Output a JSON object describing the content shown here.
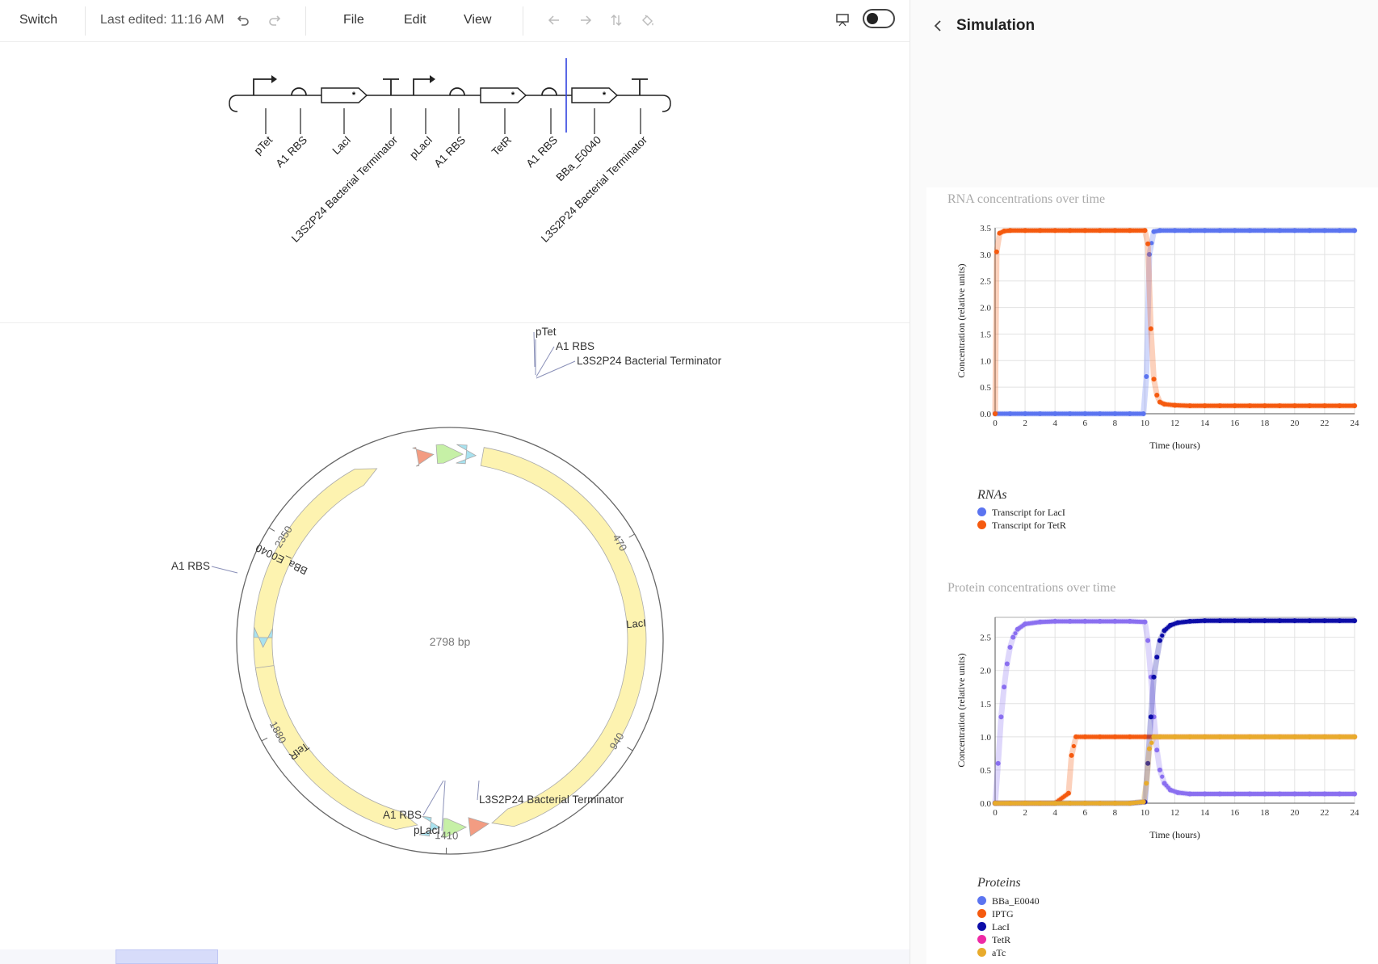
{
  "toolbar": {
    "switch_label": "Switch",
    "last_edited": "Last edited: 11:16 AM",
    "menu": [
      "File",
      "Edit",
      "View"
    ]
  },
  "linear_design": {
    "parts": [
      {
        "name": "pTet",
        "glyph": "promoter"
      },
      {
        "name": "A1 RBS",
        "glyph": "rbs"
      },
      {
        "name": "LacI",
        "glyph": "cds"
      },
      {
        "name": "L3S2P24 Bacterial Terminator",
        "glyph": "terminator"
      },
      {
        "name": "pLacI",
        "glyph": "promoter"
      },
      {
        "name": "A1 RBS",
        "glyph": "rbs"
      },
      {
        "name": "TetR",
        "glyph": "cds"
      },
      {
        "name": "A1 RBS",
        "glyph": "rbs"
      },
      {
        "name": "BBa_E0040",
        "glyph": "cds"
      },
      {
        "name": "L3S2P24 Bacterial Terminator",
        "glyph": "terminator"
      }
    ]
  },
  "plasmid": {
    "length_label": "2798 bp",
    "ticks": [
      "470",
      "940",
      "1410",
      "1880",
      "2350"
    ],
    "feature_labels": [
      "BBa_E0040",
      "LacI",
      "TetR"
    ],
    "callouts": [
      "pTet",
      "A1 RBS",
      "L3S2P24 Bacterial Terminator",
      "A1 RBS",
      "A1 RBS",
      "pLacI",
      "L3S2P24 Bacterial Terminator"
    ],
    "colors": {
      "cds": "#fdf3b0",
      "promoter": "#c6f0a6",
      "rbs": "#a8e2ef",
      "terminator": "#f39c82"
    }
  },
  "simulation": {
    "title": "Simulation",
    "rna_chart": {
      "title": "RNA concentrations over time",
      "xlabel": "Time (hours)",
      "ylabel": "Concentration (relative units)",
      "legend_title": "RNAs",
      "legend": [
        {
          "label": "Transcript for LacI",
          "color": "#5b74f0"
        },
        {
          "label": "Transcript for TetR",
          "color": "#f55a0f"
        }
      ]
    },
    "protein_chart": {
      "title": "Protein concentrations over time",
      "xlabel": "Time (hours)",
      "ylabel": "Concentration (relative units)",
      "legend_title": "Proteins",
      "legend": [
        {
          "label": "BBa_E0040",
          "color": "#5b74f0"
        },
        {
          "label": "IPTG",
          "color": "#f55a0f"
        },
        {
          "label": "LacI",
          "color": "#0d0da8"
        },
        {
          "label": "TetR",
          "color": "#ee2aa5"
        },
        {
          "label": "aTc",
          "color": "#e8ab2c"
        }
      ]
    }
  },
  "chart_data": [
    {
      "type": "scatter",
      "title": "RNA concentrations over time",
      "xlabel": "Time (hours)",
      "ylabel": "Concentration (relative units)",
      "xlim": [
        0,
        24
      ],
      "ylim": [
        0,
        3.5
      ],
      "xticks": [
        0,
        2,
        4,
        6,
        8,
        10,
        12,
        14,
        16,
        18,
        20,
        22,
        24
      ],
      "yticks": [
        0,
        0.5,
        1.0,
        1.5,
        2.0,
        2.5,
        3.0,
        3.5
      ],
      "grid": true,
      "legend_position": "bottom-left",
      "series": [
        {
          "name": "Transcript for LacI",
          "color": "#5b74f0",
          "x": [
            0,
            1,
            2,
            3,
            4,
            5,
            6,
            7,
            8,
            9,
            9.9,
            10.1,
            10.3,
            10.6,
            11,
            12,
            13,
            14,
            15,
            16,
            17,
            18,
            19,
            20,
            21,
            22,
            23,
            24
          ],
          "y": [
            0,
            0,
            0,
            0,
            0,
            0,
            0,
            0,
            0,
            0,
            0,
            0.7,
            3.0,
            3.43,
            3.45,
            3.45,
            3.45,
            3.45,
            3.45,
            3.45,
            3.45,
            3.45,
            3.45,
            3.45,
            3.45,
            3.45,
            3.45,
            3.45
          ]
        },
        {
          "name": "Transcript for TetR",
          "color": "#f55a0f",
          "x": [
            0,
            0.1,
            0.3,
            0.6,
            1,
            2,
            3,
            4,
            5,
            6,
            7,
            8,
            9,
            10,
            10.2,
            10.4,
            10.6,
            10.8,
            11,
            11.3,
            12,
            13,
            14,
            15,
            16,
            17,
            18,
            19,
            20,
            21,
            22,
            23,
            24
          ],
          "y": [
            0,
            3.05,
            3.4,
            3.44,
            3.45,
            3.45,
            3.45,
            3.45,
            3.45,
            3.45,
            3.45,
            3.45,
            3.45,
            3.45,
            3.2,
            1.6,
            0.65,
            0.35,
            0.22,
            0.18,
            0.16,
            0.15,
            0.15,
            0.15,
            0.15,
            0.15,
            0.15,
            0.15,
            0.15,
            0.15,
            0.15,
            0.15,
            0.15
          ]
        }
      ]
    },
    {
      "type": "scatter",
      "title": "Protein concentrations over time",
      "xlabel": "Time (hours)",
      "ylabel": "Concentration (relative units)",
      "xlim": [
        0,
        24
      ],
      "ylim": [
        0,
        2.8
      ],
      "xticks": [
        0,
        2,
        4,
        6,
        8,
        10,
        12,
        14,
        16,
        18,
        20,
        22,
        24
      ],
      "yticks": [
        0,
        0.5,
        1.0,
        1.5,
        2.0,
        2.5
      ],
      "grid": true,
      "legend_position": "bottom-left",
      "series": [
        {
          "name": "BBa_E0040",
          "color": "#8a6ff0",
          "x": [
            0,
            0.2,
            0.4,
            0.6,
            0.8,
            1.0,
            1.2,
            1.5,
            2,
            3,
            4,
            5,
            6,
            7,
            8,
            9,
            10,
            10.2,
            10.4,
            10.6,
            10.8,
            11,
            11.3,
            11.7,
            12.2,
            13,
            14,
            15,
            16,
            17,
            18,
            19,
            20,
            21,
            22,
            23,
            24
          ],
          "y": [
            0,
            0.6,
            1.3,
            1.75,
            2.1,
            2.35,
            2.5,
            2.62,
            2.7,
            2.73,
            2.74,
            2.74,
            2.74,
            2.74,
            2.74,
            2.74,
            2.73,
            2.45,
            1.9,
            1.3,
            0.8,
            0.5,
            0.3,
            0.2,
            0.16,
            0.14,
            0.14,
            0.14,
            0.14,
            0.14,
            0.14,
            0.14,
            0.14,
            0.14,
            0.14,
            0.14,
            0.14
          ]
        },
        {
          "name": "IPTG",
          "color": "#f55a0f",
          "x": [
            0,
            1,
            2,
            3,
            4,
            4.9,
            5.1,
            5.4,
            6,
            7,
            8,
            9,
            10,
            11,
            12,
            13,
            14,
            15,
            16,
            17,
            18,
            19,
            20,
            21,
            22,
            23,
            24
          ],
          "y": [
            0,
            0,
            0,
            0,
            0,
            0.15,
            0.72,
            1.0,
            1.0,
            1.0,
            1.0,
            1.0,
            1.0,
            1.0,
            1.0,
            1.0,
            1.0,
            1.0,
            1.0,
            1.0,
            1.0,
            1.0,
            1.0,
            1.0,
            1.0,
            1.0,
            1.0
          ]
        },
        {
          "name": "LacI",
          "color": "#0d0da8",
          "x": [
            0,
            1,
            2,
            3,
            4,
            5,
            6,
            7,
            8,
            9,
            10,
            10.2,
            10.4,
            10.6,
            10.8,
            11,
            11.3,
            11.7,
            12.2,
            13,
            14,
            15,
            16,
            17,
            18,
            19,
            20,
            21,
            22,
            23,
            24
          ],
          "y": [
            0,
            0,
            0,
            0,
            0,
            0,
            0,
            0,
            0,
            0,
            0.02,
            0.6,
            1.3,
            1.9,
            2.2,
            2.45,
            2.6,
            2.68,
            2.72,
            2.74,
            2.75,
            2.75,
            2.75,
            2.75,
            2.75,
            2.75,
            2.75,
            2.75,
            2.75,
            2.75,
            2.75
          ]
        },
        {
          "name": "aTc",
          "color": "#e8ab2c",
          "x": [
            0,
            1,
            2,
            3,
            4,
            5,
            6,
            7,
            8,
            9,
            9.9,
            10.1,
            10.3,
            10.6,
            11,
            12,
            13,
            14,
            15,
            16,
            17,
            18,
            19,
            20,
            21,
            22,
            23,
            24
          ],
          "y": [
            0,
            0,
            0,
            0,
            0,
            0,
            0,
            0,
            0,
            0,
            0.02,
            0.3,
            0.82,
            1.0,
            1.0,
            1.0,
            1.0,
            1.0,
            1.0,
            1.0,
            1.0,
            1.0,
            1.0,
            1.0,
            1.0,
            1.0,
            1.0,
            1.0
          ]
        }
      ]
    }
  ]
}
